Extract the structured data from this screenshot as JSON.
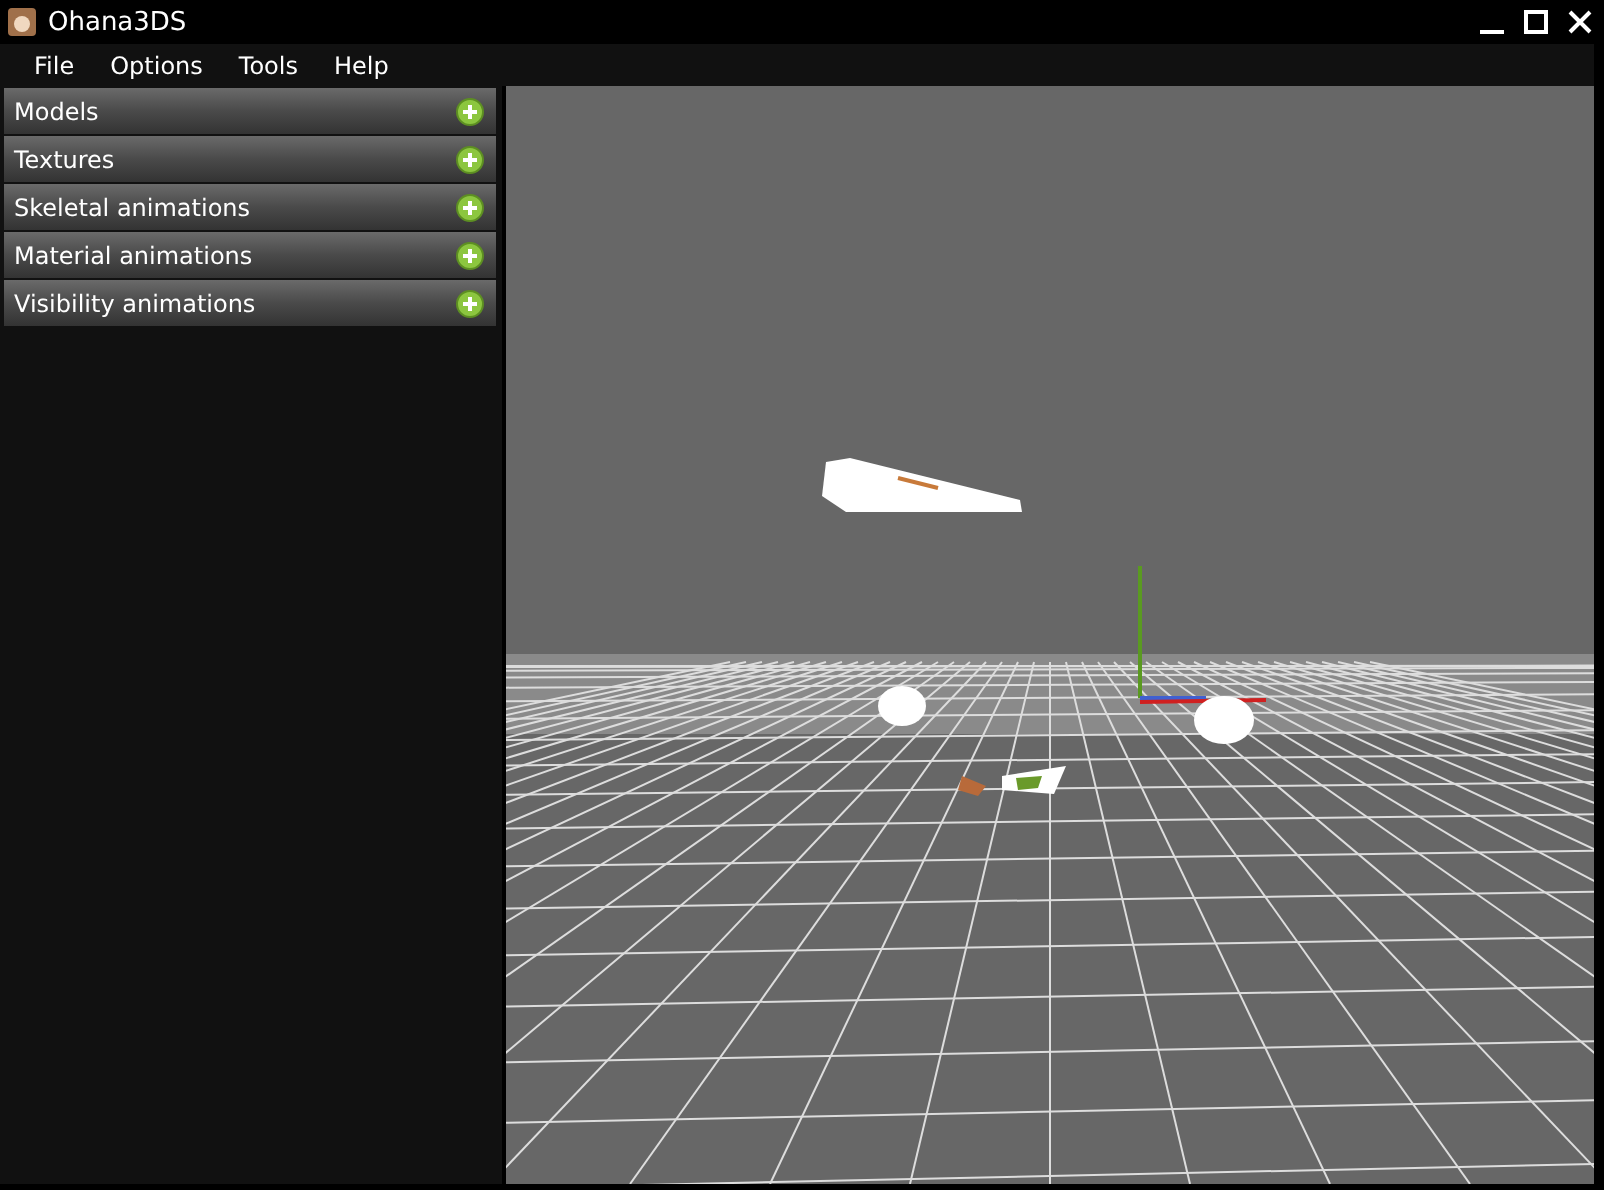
{
  "window": {
    "title": "Ohana3DS"
  },
  "menu": [
    "File",
    "Options",
    "Tools",
    "Help"
  ],
  "panels": [
    {
      "label": "Models",
      "expanded": false
    },
    {
      "label": "Textures",
      "expanded": false
    },
    {
      "label": "Skeletal animations",
      "expanded": false
    },
    {
      "label": "Material animations",
      "expanded": false
    },
    {
      "label": "Visibility animations",
      "expanded": false
    }
  ]
}
